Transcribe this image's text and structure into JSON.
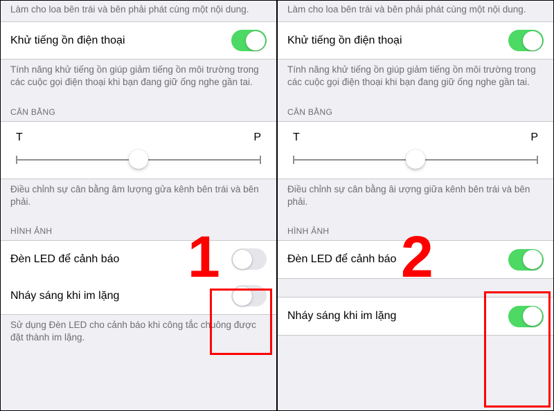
{
  "panels": [
    {
      "topDesc": "Làm cho loa bên trái và bên phải phát cùng một nội dung.",
      "noiseCancel": {
        "label": "Khử tiếng ồn điện thoại",
        "on": true,
        "desc": "Tính năng khử tiếng ồn giúp giảm tiếng ồn môi trường trong các cuộc gọi điện thoại khi bạn đang giữ ống nghe gần tai."
      },
      "balance": {
        "header": "CÂN BẰNG",
        "leftMark": "T",
        "rightMark": "P",
        "desc": "Điều chỉnh sự cân bằng âm lượng gửa kênh bên trái và bên phải."
      },
      "image": {
        "header": "HÌNH ẢNH",
        "led": {
          "label": "Đèn LED để cảnh báo",
          "on": false
        },
        "flash": {
          "label": "Nháy sáng khi im lặng",
          "on": false
        },
        "desc": "Sử dụng Đèn LED cho cảnh báo khi công tắc chuông được đặt thành im lặng."
      },
      "annotation": "1"
    },
    {
      "topDesc": "Làm cho loa bên trái và bên phải phát cùng một nội dung.",
      "noiseCancel": {
        "label": "Khử tiếng ồn điện thoại",
        "on": true,
        "desc": "Tính năng khử tiếng ồn giúp giảm tiếng ồn môi trường trong các cuộc gọi điện thoại khi bạn đang giữ ống nghe gần tai."
      },
      "balance": {
        "header": "CÂN BẰNG",
        "leftMark": "T",
        "rightMark": "P",
        "desc": "Điều chỉnh sự cân bằng âi     ượng giữa kênh bên trái và bên phải."
      },
      "image": {
        "header": "HÌNH ẢNH",
        "led": {
          "label": "Đèn LED để cảnh báo",
          "on": true
        },
        "flash": {
          "label": "Nháy sáng khi im lặng",
          "on": true
        },
        "desc": ""
      },
      "annotation": "2"
    }
  ]
}
